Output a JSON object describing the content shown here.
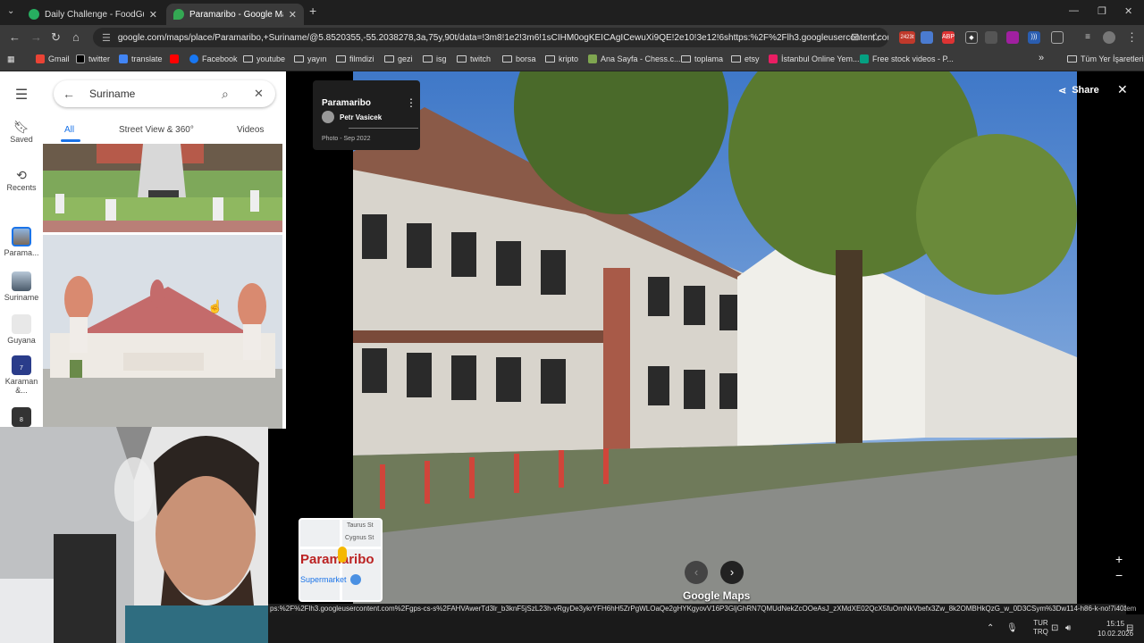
{
  "browser": {
    "tabs": [
      {
        "title": "Daily Challenge - FoodGuessr |",
        "active": false
      },
      {
        "title": "Paramaribo - Google Maps",
        "active": true
      }
    ],
    "url": "google.com/maps/place/Paramaribo,+Suriname/@5.8520355,-55.2038278,3a,75y,90t/data=!3m8!1e2!3m6!1sCIHM0ogKEICAgICewuXi9QE!2e10!3e12!6shttps:%2F%2Flh3.googleusercontent.com%2...",
    "extension_badge": "2423t",
    "bookmarks": [
      {
        "label": "Gmail",
        "icon": "gmail-icon"
      },
      {
        "label": "twitter",
        "icon": "x-icon"
      },
      {
        "label": "translate",
        "icon": "translate-icon"
      },
      {
        "label": "",
        "icon": "youtube-icon"
      },
      {
        "label": "Facebook",
        "icon": "facebook-icon"
      },
      {
        "label": "youtube",
        "icon": "folder-icon"
      },
      {
        "label": "yayın",
        "icon": "folder-icon"
      },
      {
        "label": "filmdizi",
        "icon": "folder-icon"
      },
      {
        "label": "gezi",
        "icon": "folder-icon"
      },
      {
        "label": "isg",
        "icon": "folder-icon"
      },
      {
        "label": "twitch",
        "icon": "folder-icon"
      },
      {
        "label": "borsa",
        "icon": "folder-icon"
      },
      {
        "label": "kripto",
        "icon": "folder-icon"
      },
      {
        "label": "Ana Sayfa - Chess.c...",
        "icon": "chess-icon"
      },
      {
        "label": "toplama",
        "icon": "folder-icon"
      },
      {
        "label": "etsy",
        "icon": "folder-icon"
      },
      {
        "label": "İstanbul Online Yem...",
        "icon": "yemek-icon"
      },
      {
        "label": "Free stock videos - P...",
        "icon": "pexels-icon"
      }
    ],
    "all_bookmarks": "Tüm Yer İşaretleri",
    "overflow": "»"
  },
  "rail": {
    "items": [
      {
        "label": "Saved",
        "icon": "bookmark-icon"
      },
      {
        "label": "Recents",
        "icon": "history-icon"
      },
      {
        "label": "Parama...",
        "icon": "paramaribo-thumb"
      },
      {
        "label": "Suriname",
        "icon": "suriname-thumb"
      },
      {
        "label": "Guyana",
        "icon": "guyana-thumb"
      },
      {
        "label": "Karaman &...",
        "icon": "karaman-thumb",
        "badge": "7"
      },
      {
        "label": "",
        "icon": "extra-thumb",
        "badge": "8"
      }
    ]
  },
  "panel": {
    "search_value": "Suriname",
    "tabs": [
      "All",
      "Street View & 360°",
      "Videos"
    ],
    "active_tab": "All"
  },
  "viewer": {
    "place_name": "Paramaribo",
    "author": "Petr Vasicek",
    "date": "Photo - Sep 2022",
    "share_label": "Share",
    "brand": "Google Maps",
    "minimap": {
      "streets": [
        "Taurus St",
        "Cygnus St"
      ],
      "city": "Paramaribo",
      "poi": "Supermarket"
    }
  },
  "status_url": "ps:%2F%2Flh3.googleusercontent.com%2Fgps-cs-s%2FAHVAwerTd3lr_b3knF5jSzL23h-vRgyDe3ykrYFH6hH5ZrPgWLOaQe2gHYKgyovV16P3GljGhRN7QMUdNekZcOOeAsJ_zXMdXE02QcX5fuOmNkVbefx3Zw_8k2OMBHkQzG_w_0D3CSym%3Dw114-h86-k-no!7i4032!8i3024...",
  "status_suffix": "tem",
  "taskbar": {
    "lang": "TUR",
    "lang2": "TRQ",
    "time": "15:15",
    "date": "10.02.2026"
  }
}
